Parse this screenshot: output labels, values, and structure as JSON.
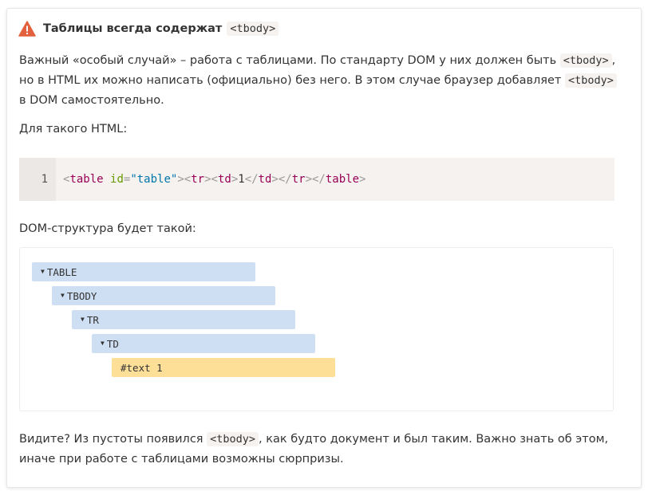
{
  "heading": {
    "icon": "warning-icon",
    "title": "Таблицы всегда содержат",
    "code": "<tbody>"
  },
  "para1": {
    "t1": "Важный «особый случай» – работа с таблицами. По стандарту DOM у них должен быть ",
    "c1": "<tbody>",
    "t2": ", но в HTML их можно написать (официально) без него. В этом случае браузер добавляет ",
    "c2": "<tbody>",
    "t3": " в DOM самостоятельно."
  },
  "para2": "Для такого HTML:",
  "code_block": {
    "line_number": "1",
    "tokens": {
      "lt1": "<",
      "table_tag": "table",
      "sp": " ",
      "attr": "id",
      "eq": "=",
      "val": "\"table\"",
      "gt1": ">",
      "lt2": "<",
      "tr_tag": "tr",
      "gt2": ">",
      "lt3": "<",
      "td_tag": "td",
      "gt3": ">",
      "text": "1",
      "lt4": "</",
      "td_close": "td",
      "gt4": ">",
      "lt5": "</",
      "tr_close": "tr",
      "gt5": ">",
      "lt6": "</",
      "table_close": "table",
      "gt6": ">"
    }
  },
  "para3": "DOM-структура будет такой:",
  "dom_tree": {
    "nodes": [
      {
        "label": "TABLE",
        "arrow": "▼"
      },
      {
        "label": "TBODY",
        "arrow": "▼"
      },
      {
        "label": "TR",
        "arrow": "▼"
      },
      {
        "label": "TD",
        "arrow": "▼"
      },
      {
        "label": "#text 1"
      }
    ],
    "colors": {
      "element": "#cfdff3",
      "text": "#fddf98"
    }
  },
  "para4": {
    "t1": "Видите? Из пустоты появился ",
    "c1": "<tbody>",
    "t2": ", как будто документ и был таким. Важно знать об этом, иначе при работе с таблицами возможны сюрпризы."
  }
}
